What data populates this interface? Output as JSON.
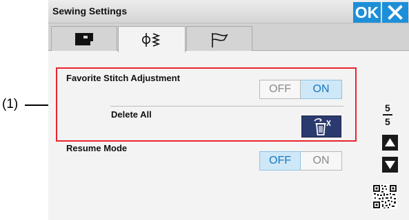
{
  "callout": {
    "label": "(1)"
  },
  "titlebar": {
    "title": "Sewing Settings",
    "ok_label": "OK"
  },
  "tabs": [
    {
      "icon": "sewing-machine-icon",
      "active": false
    },
    {
      "icon": "stitch-icon",
      "active": true
    },
    {
      "icon": "flag-icon",
      "active": false
    }
  ],
  "settings": {
    "favorite": {
      "label": "Favorite Stitch Adjustment",
      "off_label": "OFF",
      "on_label": "ON",
      "state": "ON"
    },
    "delete_all": {
      "label": "Delete All",
      "icon": "trash-delete-icon"
    },
    "resume": {
      "label": "Resume Mode",
      "off_label": "OFF",
      "on_label": "ON",
      "state": "OFF"
    }
  },
  "pager": {
    "current": "5",
    "total": "5"
  },
  "colors": {
    "accent": "#1d8fd8",
    "highlight": "#e8242c",
    "selected_bg": "#cfe8f7",
    "dark_button": "#2b3a6e"
  }
}
